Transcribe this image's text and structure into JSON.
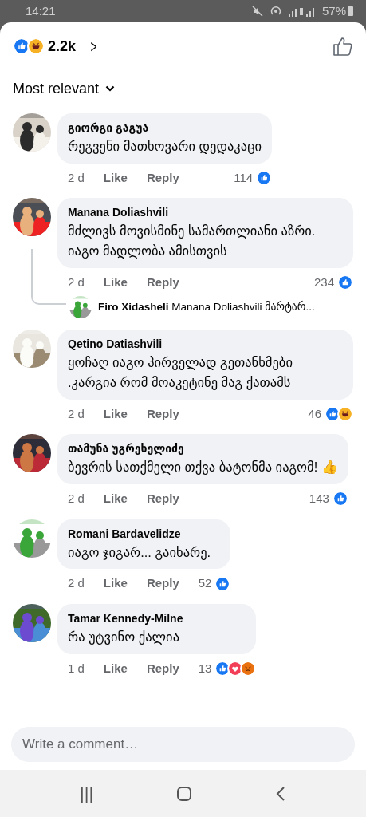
{
  "status_bar": {
    "time": "14:21",
    "battery": "57%"
  },
  "header": {
    "reactions": [
      {
        "kind": "like"
      },
      {
        "kind": "haha"
      }
    ],
    "count": "2.2k",
    "chevron": ">"
  },
  "sort": {
    "label": "Most relevant"
  },
  "comments": [
    {
      "author": "გიორგი გაგუა",
      "text": "რეგვენი მათხოვარი დედაკაცი",
      "time": "2 d",
      "like": "Like",
      "reply": "Reply",
      "count": "114",
      "reactions": [
        {
          "kind": "like"
        }
      ]
    },
    {
      "author": "Manana Doliashvili",
      "text": "მძლივს მოვისმინე სამართლიანი აზრი. იაგო მადლობა ამისთვის",
      "time": "2 d",
      "like": "Like",
      "reply": "Reply",
      "count": "234",
      "reactions": [
        {
          "kind": "like"
        }
      ],
      "children": [
        {
          "author": "Firo Xidasheli",
          "text": "Manana Doliashvili მარტარ..."
        }
      ]
    },
    {
      "author": "Qetino Datiashvili",
      "text": "ყოჩაღ  იაგო  პირველად  გეთანხმები  .კარგია  რომ  მოაკეტინე  მაგ ქათამს",
      "time": "2 d",
      "like": "Like",
      "reply": "Reply",
      "count": "46",
      "reactions": [
        {
          "kind": "like"
        },
        {
          "kind": "haha"
        }
      ]
    },
    {
      "author": "თამუნა უგრეხელიძე",
      "text": "ბევრის სათქმელი თქვა ბატონმა იაგომ! 👍",
      "time": "2 d",
      "like": "Like",
      "reply": "Reply",
      "count": "143",
      "reactions": [
        {
          "kind": "like"
        }
      ]
    },
    {
      "author": "Romani Bardavelidze",
      "text": "იაგო ჯიგარ... გაიხარე.",
      "time": "2 d",
      "like": "Like",
      "reply": "Reply",
      "count": "52",
      "reactions": [
        {
          "kind": "like"
        }
      ]
    },
    {
      "author": "Tamar Kennedy-Milne",
      "text": "რა უტვინო ქალია",
      "time": "1 d",
      "like": "Like",
      "reply": "Reply",
      "count": "13",
      "reactions": [
        {
          "kind": "like"
        },
        {
          "kind": "love"
        },
        {
          "kind": "angry"
        }
      ]
    }
  ],
  "composer": {
    "placeholder": "Write a comment…"
  },
  "nav": {
    "recents": "|||"
  }
}
